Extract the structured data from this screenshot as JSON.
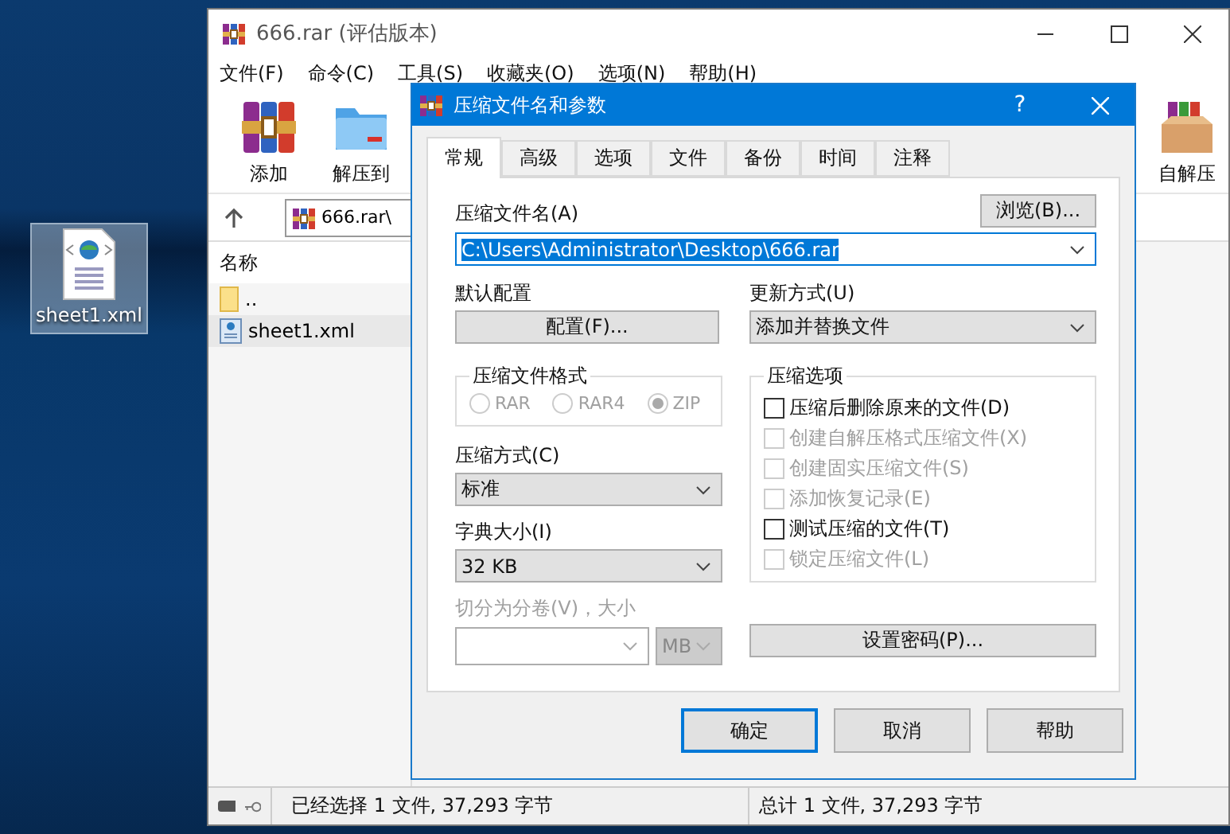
{
  "desktop_icons": [
    {
      "label": "sheet1.xml",
      "selected": true
    }
  ],
  "main_window": {
    "title": "666.rar (评估版本)",
    "menu": [
      "文件(F)",
      "命令(C)",
      "工具(S)",
      "收藏夹(O)",
      "选项(N)",
      "帮助(H)"
    ],
    "toolbar": [
      {
        "label": "添加",
        "kind": "add"
      },
      {
        "label": "解压到",
        "kind": "extract"
      },
      {
        "label": "自解压",
        "kind": "sfx"
      }
    ],
    "address": "666.rar\\",
    "columns": [
      "名称"
    ],
    "files": [
      {
        "name": "..",
        "kind": "folder",
        "selected": false
      },
      {
        "name": "sheet1.xml",
        "kind": "xml",
        "selected": true
      }
    ],
    "status": [
      "已经选择 1 文件, 37,293 字节",
      "总计 1 文件, 37,293 字节"
    ]
  },
  "dialog": {
    "title": "压缩文件名和参数",
    "help_glyph": "?",
    "tabs": [
      {
        "label": "常规",
        "selected": true
      },
      {
        "label": "高级",
        "selected": false
      },
      {
        "label": "选项",
        "selected": false
      },
      {
        "label": "文件",
        "selected": false
      },
      {
        "label": "备份",
        "selected": false
      },
      {
        "label": "时间",
        "selected": false
      },
      {
        "label": "注释",
        "selected": false
      }
    ],
    "archive_name": {
      "label": "压缩文件名(A)",
      "value": "C:\\Users\\Administrator\\Desktop\\666.rar",
      "highlighted": true
    },
    "browse_button": "浏览(B)...",
    "profile": {
      "label": "默认配置",
      "button": "配置(F)..."
    },
    "update_mode": {
      "label": "更新方式(U)",
      "value": "添加并替换文件"
    },
    "format": {
      "label": "压缩文件格式",
      "disabled": true,
      "options": [
        {
          "label": "RAR",
          "selected": false
        },
        {
          "label": "RAR4",
          "selected": false
        },
        {
          "label": "ZIP",
          "selected": true
        }
      ]
    },
    "method": {
      "label": "压缩方式(C)",
      "value": "标准"
    },
    "dictionary": {
      "label": "字典大小(I)",
      "value": "32 KB"
    },
    "split": {
      "label": "切分为分卷(V)，大小",
      "unit": "MB",
      "disabled": true
    },
    "options": {
      "label": "压缩选项",
      "items": [
        {
          "label": "压缩后删除原来的文件(D)",
          "checked": false,
          "disabled": false
        },
        {
          "label": "创建自解压格式压缩文件(X)",
          "checked": false,
          "disabled": true
        },
        {
          "label": "创建固实压缩文件(S)",
          "checked": false,
          "disabled": true
        },
        {
          "label": "添加恢复记录(E)",
          "checked": false,
          "disabled": true
        },
        {
          "label": "测试压缩的文件(T)",
          "checked": false,
          "disabled": false
        },
        {
          "label": "锁定压缩文件(L)",
          "checked": false,
          "disabled": true
        }
      ]
    },
    "password_button": "设置密码(P)...",
    "buttons": [
      {
        "label": "确定",
        "default": true
      },
      {
        "label": "取消",
        "default": false
      },
      {
        "label": "帮助",
        "default": false
      }
    ]
  }
}
